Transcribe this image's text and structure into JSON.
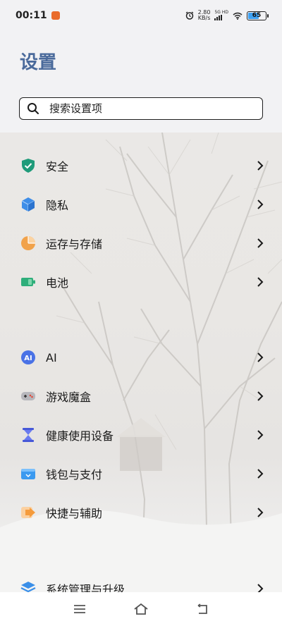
{
  "status_bar": {
    "time": "00:11",
    "net_speed_value": "2.80",
    "net_speed_unit": "KB/s",
    "network_type": "5G HD",
    "battery_level": "65",
    "battery_fraction": 0.65
  },
  "page_title": "设置",
  "search": {
    "placeholder": "搜索设置项"
  },
  "settings": [
    {
      "label": "安全",
      "icon": "shield-check-icon"
    },
    {
      "label": "隐私",
      "icon": "privacy-cube-icon"
    },
    {
      "label": "运存与存储",
      "icon": "storage-pie-icon"
    },
    {
      "label": "电池",
      "icon": "battery-icon"
    },
    {
      "label": "AI",
      "icon": "ai-icon"
    },
    {
      "label": "游戏魔盒",
      "icon": "gamepad-icon"
    },
    {
      "label": "健康使用设备",
      "icon": "hourglass-icon"
    },
    {
      "label": "钱包与支付",
      "icon": "wallet-icon"
    },
    {
      "label": "快捷与辅助",
      "icon": "shortcut-icon"
    },
    {
      "label": "系统管理与升级",
      "icon": "system-update-icon"
    }
  ],
  "colors": {
    "title": "#4a6a9b",
    "shield": "#1f9b7a",
    "privacy": "#3f8ee8",
    "storage": "#f1a24a",
    "battery": "#2eae7a",
    "ai": "#4a72e6",
    "hourglass": "#4658d8",
    "wallet": "#3b9af0",
    "shortcut": "#f59b3c",
    "system": "#3a8fe8"
  }
}
